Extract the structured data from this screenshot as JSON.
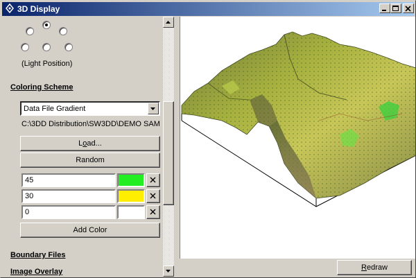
{
  "window": {
    "title": "3D Display"
  },
  "light": {
    "label": "(Light Position)",
    "selected": 1
  },
  "coloring": {
    "heading": "Coloring Scheme",
    "scheme": "Data File Gradient",
    "path": "C:\\3DD Distribution\\SW3DD\\DEMO SAM",
    "load_pre": "L",
    "load_key": "o",
    "load_post": "ad...",
    "random_label": "Random",
    "stops": [
      {
        "value": "45",
        "color": "#22ee22"
      },
      {
        "value": "30",
        "color": "#ffee00"
      },
      {
        "value": "0",
        "color": "#ffffff"
      }
    ],
    "add_color_label": "Add Color"
  },
  "sections": {
    "boundary": "Boundary Files",
    "overlay": "Image Overlay"
  },
  "view": {
    "redraw_key": "R",
    "redraw_rest": "edraw"
  },
  "colors": {
    "title_start": "#0a246a",
    "title_end": "#a6caf0",
    "window_bg": "#d4d0c8"
  }
}
